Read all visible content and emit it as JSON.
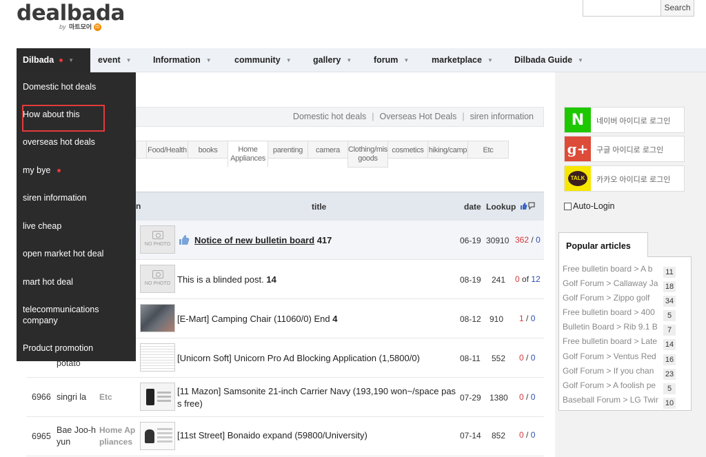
{
  "header": {
    "logo": "dealbada",
    "logo_by": "by",
    "logo_brand": "마트모어",
    "logo_badge": "㈜",
    "search_placeholder": "",
    "search_button": "Search"
  },
  "nav": {
    "items": [
      "Dilbada",
      "event",
      "Information",
      "community",
      "gallery",
      "forum",
      "marketplace",
      "Dilbada Guide"
    ],
    "caret": "▼"
  },
  "dropdown": {
    "items": [
      "Domestic hot deals",
      "How about this",
      "overseas hot deals",
      "my bye",
      "siren information",
      "live cheap",
      "open market hot deal",
      "mart hot deal",
      "telecommunications company",
      "Product promotion"
    ]
  },
  "subnav": {
    "links": [
      "Domestic hot deals",
      "Overseas Hot Deals",
      "siren information"
    ],
    "sep": "|"
  },
  "categories": [
    "",
    "Food/Health",
    "books",
    "Home Appliances",
    "parenting",
    "camera",
    "Clothing/misc goods",
    "cosmetics",
    "hiking/camp",
    "Etc"
  ],
  "table": {
    "partial_header": "n",
    "headers": {
      "title": "title",
      "date": "date",
      "lookup": "Lookup"
    },
    "thumb_label": "NO PHOTO",
    "rows": [
      {
        "no": "",
        "author": "",
        "cat": "",
        "title": "Notice of new bulletin board",
        "comments": "417",
        "date": "06-19",
        "lookup": "30910",
        "up": "362",
        "sep": "/",
        "down": "0"
      },
      {
        "no": "",
        "author": "",
        "cat": "",
        "title": "This is a blinded post.",
        "comments": "14",
        "date": "08-19",
        "lookup": "241",
        "up": "0",
        "sep": "of",
        "down": "12"
      },
      {
        "no": "",
        "author": "",
        "cat": "",
        "title": "[E-Mart] Camping Chair (11060/0) End",
        "comments": "4",
        "date": "08-12",
        "lookup": "910",
        "up": "1",
        "sep": "/",
        "down": "0"
      },
      {
        "no": "",
        "author": "potato",
        "cat": "",
        "title": "[Unicorn Soft] Unicorn Pro Ad Blocking Application (1,5800/0)",
        "comments": "",
        "date": "08-11",
        "lookup": "552",
        "up": "0",
        "sep": "/",
        "down": "0"
      },
      {
        "no": "6966",
        "author": "singri la",
        "cat": "Etc",
        "title": "[11 Mazon] Samsonite 21-inch Carrier Navy (193,190 won~/space pass free)",
        "comments": "",
        "date": "07-29",
        "lookup": "1380",
        "up": "0",
        "sep": "/",
        "down": "0"
      },
      {
        "no": "6965",
        "author": "Bae Joo-hyun",
        "cat": "Home Appliances",
        "title": "[11st Street] Bonaido expand (59800/University)",
        "comments": "",
        "date": "07-14",
        "lookup": "852",
        "up": "0",
        "sep": "/",
        "down": "0"
      }
    ]
  },
  "sidebar": {
    "login": [
      {
        "icon": "N",
        "label": "네이버 아이디로 로그인",
        "color": "#1ec800"
      },
      {
        "icon": "g+",
        "label": "구글 아이디로 로그인",
        "color": "#dd4b39"
      },
      {
        "icon": "TALK",
        "label": "카카오 아이디로 로그인",
        "color": "#f7e600"
      }
    ],
    "auto_login": "Auto-Login",
    "popular_title": "Popular articles",
    "popular": [
      {
        "text": "Free bulletin board > A b",
        "count": "11"
      },
      {
        "text": "Golf Forum > Callaway Ja",
        "count": "18"
      },
      {
        "text": "Golf Forum > Zippo golf",
        "count": "34"
      },
      {
        "text": "Free bulletin board > 400",
        "count": "5"
      },
      {
        "text": "Bulletin Board > Rib 9.1 B",
        "count": "7"
      },
      {
        "text": "Free bulletin board > Late",
        "count": "14"
      },
      {
        "text": "Golf Forum > Ventus Red",
        "count": "16"
      },
      {
        "text": "Golf Forum > If you chan",
        "count": "23"
      },
      {
        "text": "Golf Forum > A foolish pe",
        "count": "5"
      },
      {
        "text": "Baseball Forum > LG Twir",
        "count": "10"
      }
    ]
  }
}
